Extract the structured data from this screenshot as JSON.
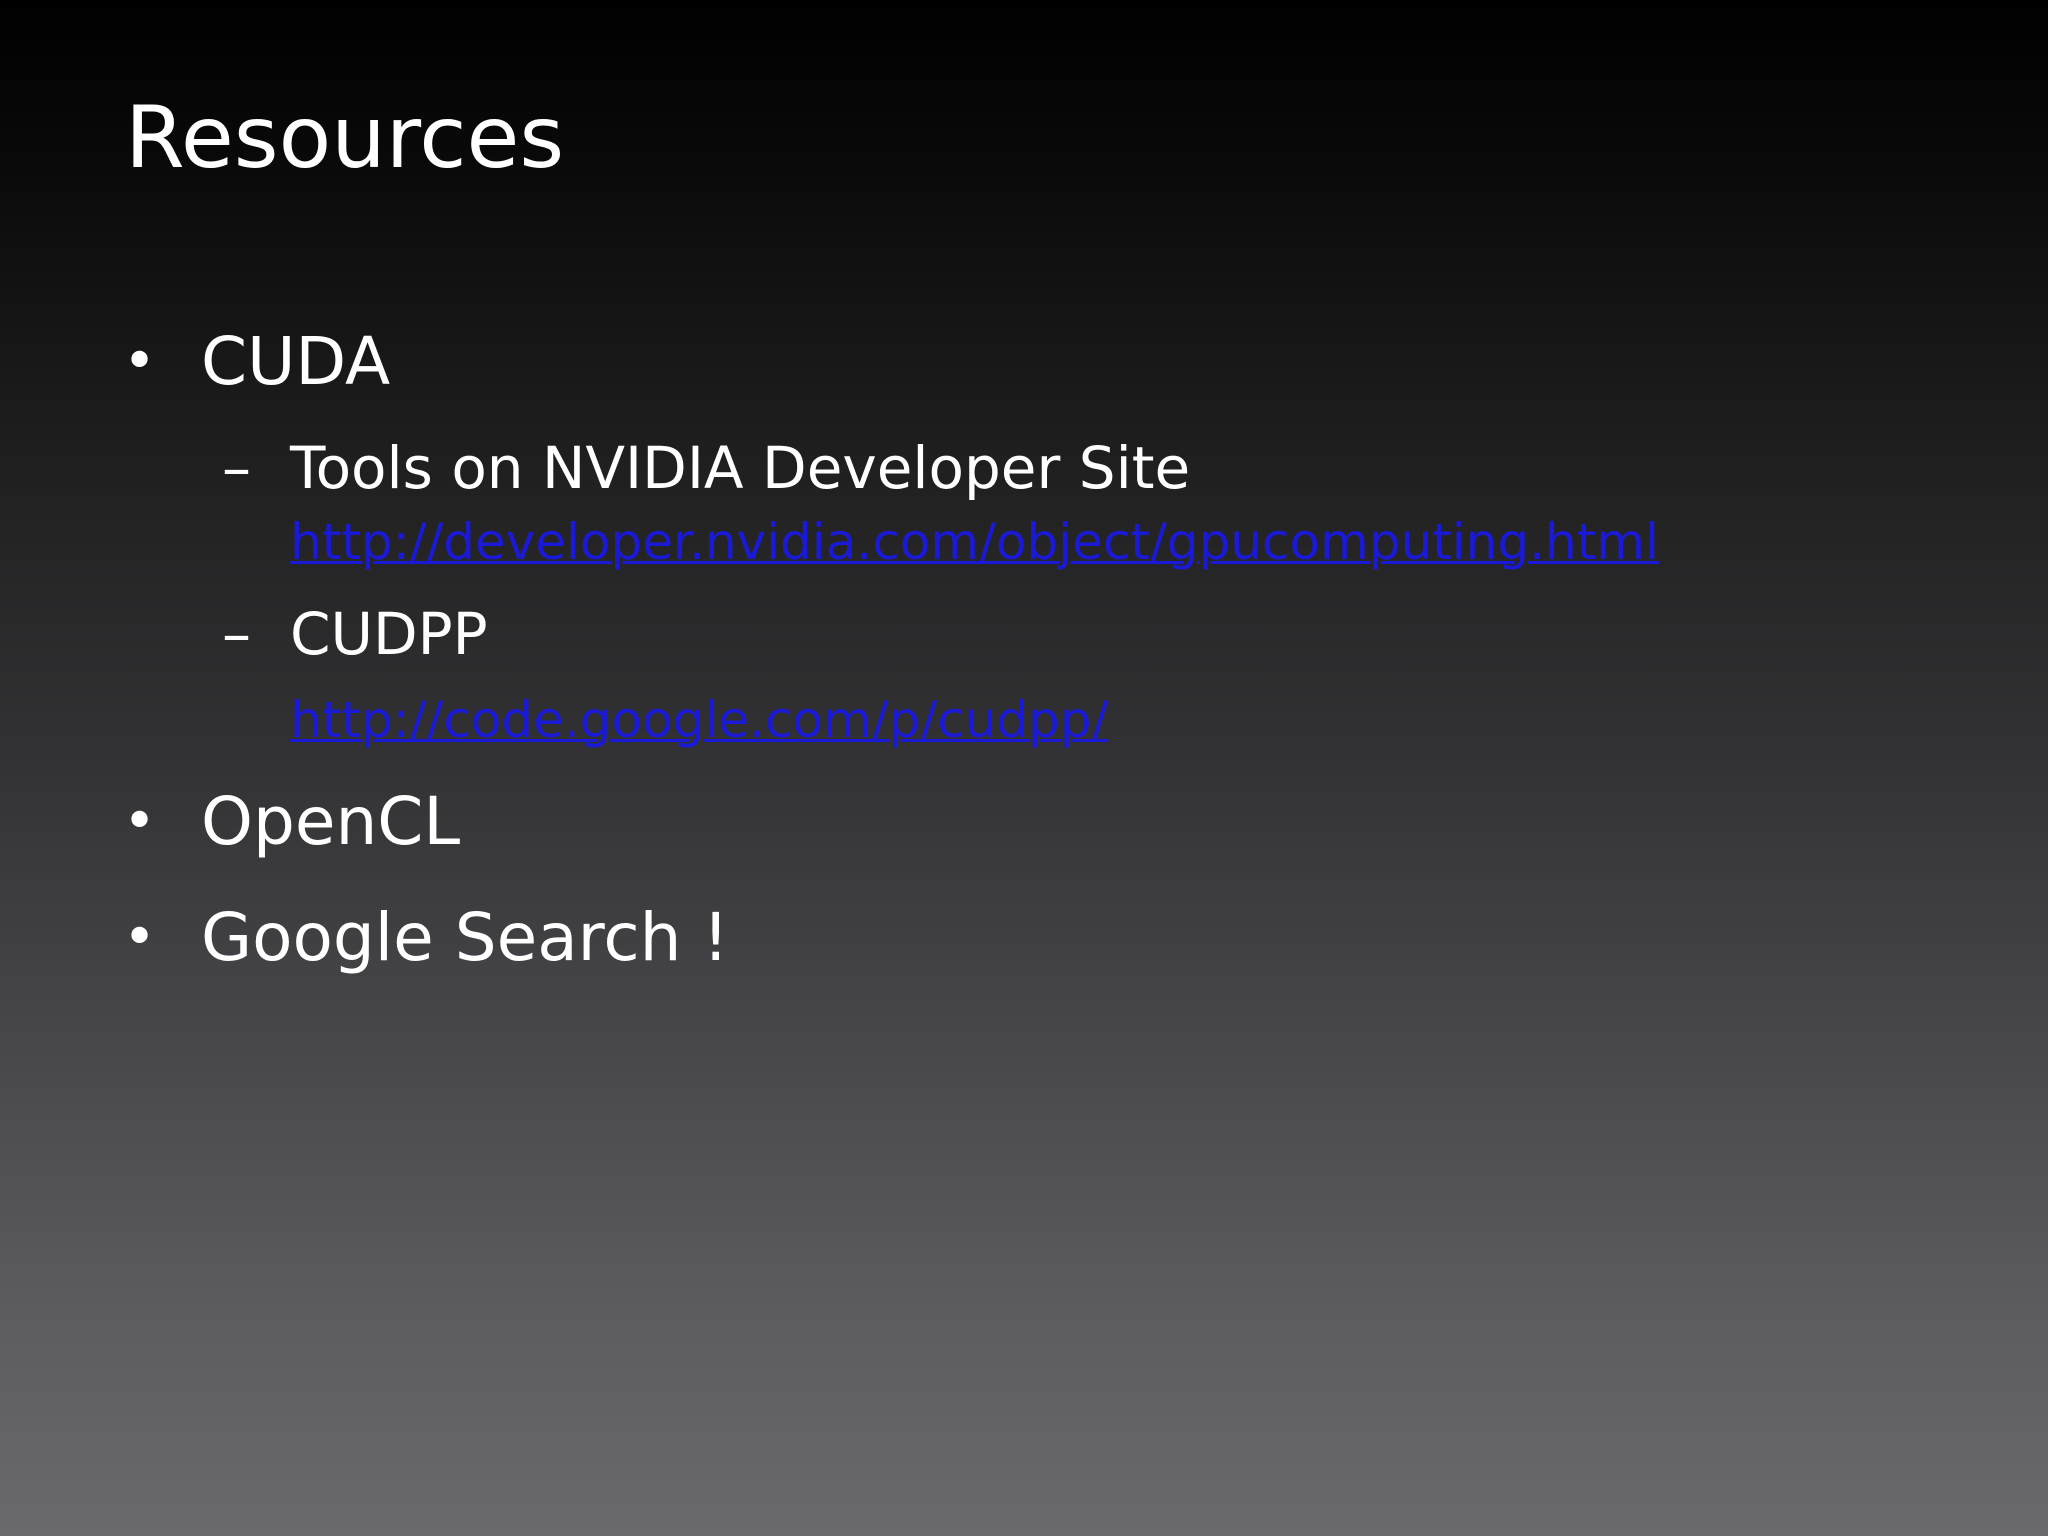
{
  "slide": {
    "title": "Resources",
    "bullets": [
      {
        "label": "CUDA",
        "marker": "•",
        "subitems": [
          {
            "marker": "–",
            "label": "Tools on NVIDIA Developer Site",
            "link": "http://developer.nvidia.com/object/gpucomputing.html"
          },
          {
            "marker": "–",
            "label": "CUDPP",
            "link": "http://code.google.com/p/cudpp/"
          }
        ]
      },
      {
        "label": "OpenCL",
        "marker": "•"
      },
      {
        "label": "Google Search !",
        "marker": "•"
      }
    ]
  },
  "colors": {
    "text": "#ffffff",
    "link": "#1a1ad6",
    "background_top": "#000000",
    "background_bottom": "#6a696c"
  }
}
